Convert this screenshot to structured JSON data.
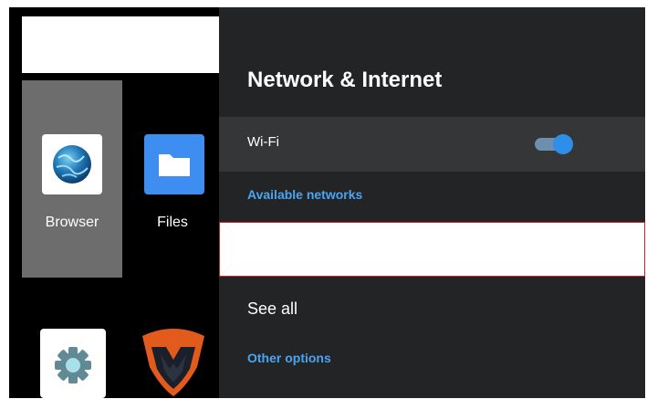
{
  "launcher": {
    "apps": [
      {
        "label": "Browser",
        "icon": "browser-globe-icon"
      },
      {
        "label": "Files",
        "icon": "folder-icon"
      },
      {
        "label": "",
        "icon": "gear-icon"
      },
      {
        "label": "",
        "icon": "shield-logo-icon"
      }
    ]
  },
  "settings": {
    "title": "Network & Internet",
    "wifi": {
      "label": "Wi-Fi",
      "enabled": true
    },
    "available_networks_label": "Available networks",
    "see_all_label": "See all",
    "other_options_label": "Other options"
  },
  "colors": {
    "accent_blue": "#4ba4f2",
    "toggle_knob": "#2f8fe8",
    "panel_bg": "#232425",
    "focus_border": "#c8252b"
  }
}
